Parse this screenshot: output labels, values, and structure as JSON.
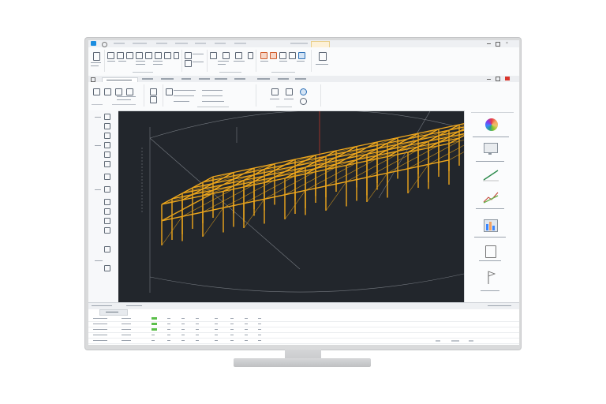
{
  "app": {
    "accent": "#1b8de0",
    "viewport_bg": "#22262c",
    "structure_color": "#f0a81c"
  },
  "ribbon_top": {
    "tabs": [
      "",
      "",
      "",
      "",
      "",
      "",
      "",
      ""
    ],
    "icons": [
      "new-file-icon",
      "open-icon",
      "save-icon",
      "undo-icon",
      "redo-icon",
      "select-icon",
      "move-icon",
      "rotate-icon",
      "scale-icon",
      "beam-icon",
      "column-icon",
      "brace-icon",
      "slab-icon",
      "grid-icon",
      "level-icon",
      "measure-icon",
      "section-icon",
      "render-icon",
      "material-icon",
      "analysis-icon",
      "export-icon"
    ]
  },
  "ribbon_bottom": {
    "icons": [
      "view-icon",
      "pan-icon",
      "zoom-icon",
      "orbit-icon",
      "layer-icon",
      "filter-icon",
      "property-icon",
      "snap-icon",
      "lock-icon",
      "shield-icon",
      "person-icon"
    ]
  },
  "left_toolbar": {
    "icons": [
      "cursor-icon",
      "line-icon",
      "node-icon",
      "member-icon",
      "support-icon",
      "load-icon",
      "dimension-icon",
      "text-icon",
      "hide-icon",
      "show-icon",
      "isolate-icon",
      "section-cut-icon",
      "annotate-icon",
      "measure-icon"
    ]
  },
  "right_panel": {
    "items": [
      {
        "icon": "color-wheel-icon",
        "label": ""
      },
      {
        "icon": "monitor-preview-icon",
        "label": ""
      },
      {
        "icon": "line-chart-icon",
        "label": ""
      },
      {
        "icon": "trend-chart-icon",
        "label": ""
      },
      {
        "icon": "bar-chart-icon",
        "label": ""
      },
      {
        "icon": "panel-icon",
        "label": ""
      },
      {
        "icon": "flag-icon",
        "label": ""
      }
    ]
  },
  "status": {
    "left": "",
    "right": ""
  },
  "bottom_table": {
    "tab_label": "",
    "rows": 5
  }
}
